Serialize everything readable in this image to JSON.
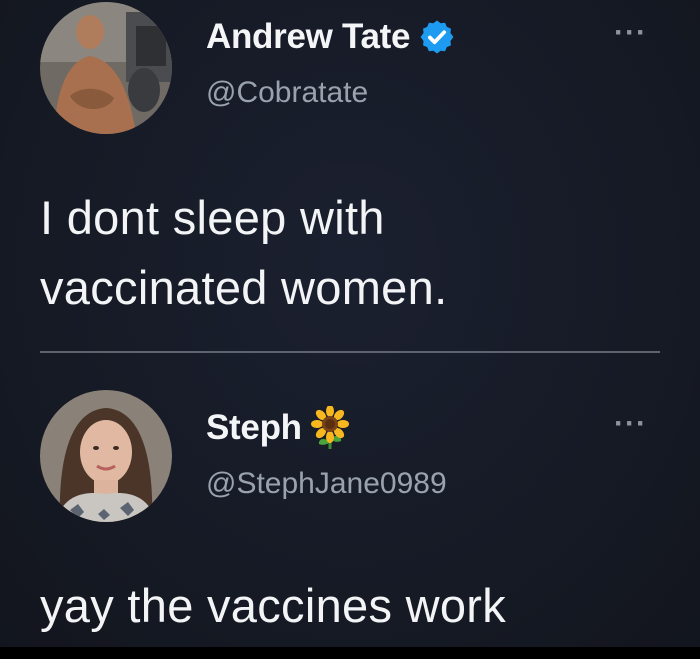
{
  "tweets": [
    {
      "display_name": "Andrew Tate",
      "handle": "@Cobratate",
      "verified": true,
      "badge_icon": "verified-badge-icon",
      "text": "I dont sleep with\nvaccinated women.",
      "more_label": "···"
    },
    {
      "display_name": "Steph",
      "handle": "@StephJane0989",
      "verified": false,
      "badge_icon": "sunflower-emoji-icon",
      "text": "yay the vaccines work",
      "more_label": "···"
    }
  ],
  "colors": {
    "background": "#161a24",
    "verified_blue": "#1d9bf0",
    "handle_gray": "#9aa3ad",
    "divider": "#5d6470"
  }
}
